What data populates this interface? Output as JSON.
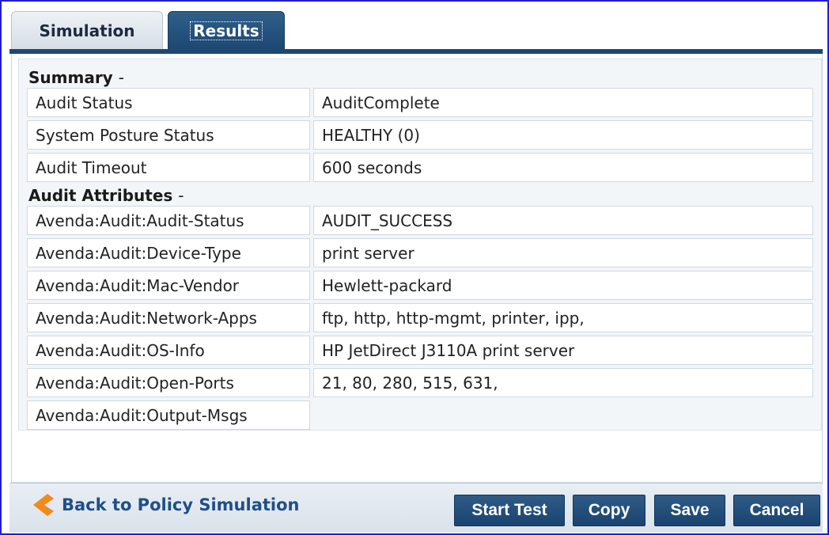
{
  "tabs": [
    {
      "label": "Simulation",
      "active": false
    },
    {
      "label": "Results",
      "active": true
    }
  ],
  "summary": {
    "heading": "Summary",
    "dash": "-",
    "rows": [
      {
        "key": "Audit Status",
        "value": "AuditComplete"
      },
      {
        "key": "System Posture Status",
        "value": "HEALTHY (0)"
      },
      {
        "key": "Audit Timeout",
        "value": "600 seconds"
      }
    ]
  },
  "audit_attributes": {
    "heading": "Audit Attributes",
    "dash": "-",
    "rows": [
      {
        "key": "Avenda:Audit:Audit-Status",
        "value": "AUDIT_SUCCESS"
      },
      {
        "key": "Avenda:Audit:Device-Type",
        "value": "print server"
      },
      {
        "key": "Avenda:Audit:Mac-Vendor",
        "value": "Hewlett-packard"
      },
      {
        "key": "Avenda:Audit:Network-Apps",
        "value": "ftp, http, http-mgmt, printer, ipp,"
      },
      {
        "key": "Avenda:Audit:OS-Info",
        "value": "HP JetDirect J3110A print server"
      },
      {
        "key": "Avenda:Audit:Open-Ports",
        "value": "21, 80, 280, 515, 631,"
      },
      {
        "key": "Avenda:Audit:Output-Msgs",
        "value": ""
      }
    ]
  },
  "footer": {
    "back_label": "Back to Policy Simulation",
    "back_icon": "chevron-left-icon",
    "buttons": {
      "start_test": "Start Test",
      "copy": "Copy",
      "save": "Save",
      "cancel": "Cancel"
    }
  },
  "colors": {
    "frame_border": "#1e1ecf",
    "tab_active_bg": "#1d4873",
    "button_bg": "#1a4370",
    "link_text": "#1f4f86",
    "chevron": "#f08a1c"
  }
}
